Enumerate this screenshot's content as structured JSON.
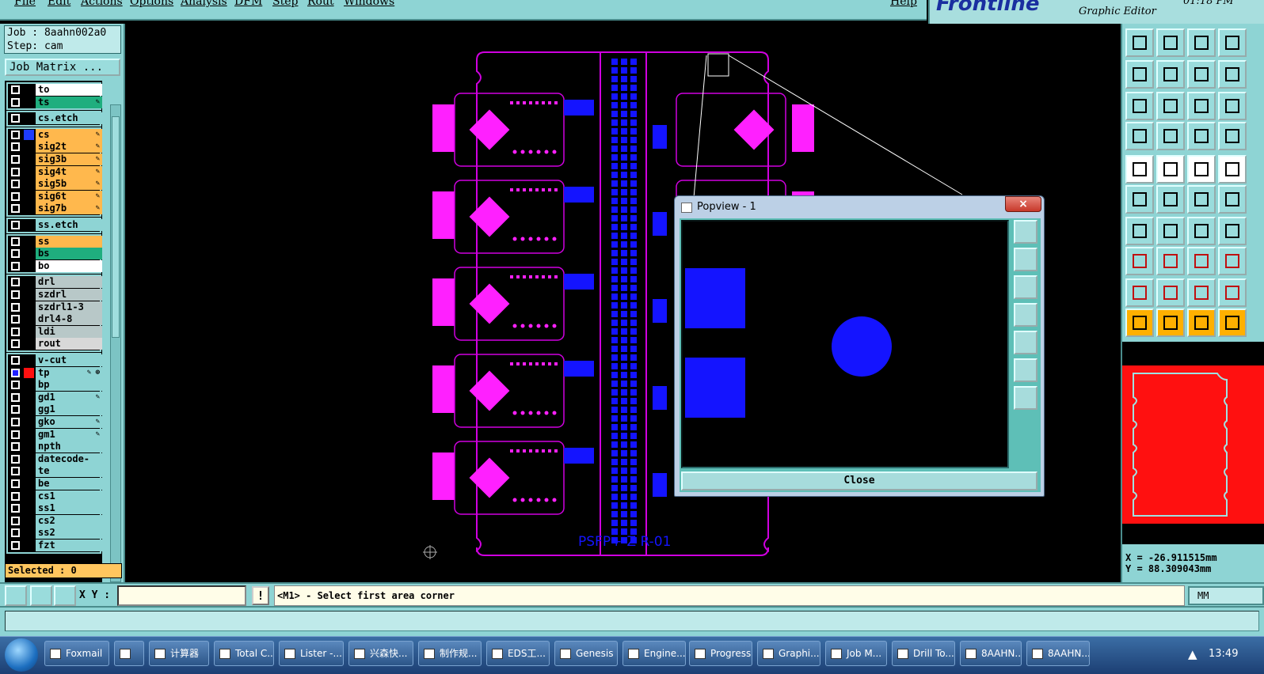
{
  "menu": {
    "items": [
      "File",
      "Edit",
      "Actions",
      "Options",
      "Analysis",
      "DFM",
      "Step",
      "Rout",
      "Windows"
    ],
    "help": "Help"
  },
  "logo": {
    "brand": "Frontline",
    "subtitle": "Graphic Editor",
    "time": "01:18 PM"
  },
  "job": {
    "job_line": "Job : 8aahn002a0",
    "step_line": "Step: cam",
    "matrix_button": "Job Matrix ..."
  },
  "layers": [
    {
      "group": [
        {
          "name": "to",
          "color": "#ffffff",
          "fg": "#000"
        },
        {
          "name": "ts",
          "color": "#1fae7e",
          "fg": "#000",
          "flag": "✎"
        }
      ]
    },
    {
      "group": [
        {
          "name": "cs.etch",
          "color": "#8ed4d4",
          "fg": "#000"
        }
      ]
    },
    {
      "group": [
        {
          "name": "cs",
          "color": "#ffb84d",
          "swatch": "#1e3cff",
          "flag": "✎"
        },
        {
          "name": "sig2t",
          "color": "#ffb84d",
          "flag": "✎"
        },
        {
          "name": "sig3b",
          "color": "#ffb84d",
          "flag": "✎"
        },
        {
          "name": "sig4t",
          "color": "#ffb84d",
          "flag": "✎"
        },
        {
          "name": "sig5b",
          "color": "#ffb84d",
          "flag": "✎"
        },
        {
          "name": "sig6t",
          "color": "#ffb84d",
          "flag": "✎"
        },
        {
          "name": "sig7b",
          "color": "#ffb84d",
          "flag": "✎"
        }
      ]
    },
    {
      "group": [
        {
          "name": "ss.etch",
          "color": "#8ed4d4"
        }
      ]
    },
    {
      "group": [
        {
          "name": "ss",
          "color": "#ffb84d"
        },
        {
          "name": "bs",
          "color": "#1fae7e"
        },
        {
          "name": "bo",
          "color": "#ffffff"
        }
      ]
    },
    {
      "group": [
        {
          "name": "drl",
          "color": "#b8c8c8"
        },
        {
          "name": "szdrl",
          "color": "#b8c8c8"
        },
        {
          "name": "szdrl1-3",
          "color": "#b8c8c8"
        },
        {
          "name": "drl4-8",
          "color": "#b8c8c8"
        },
        {
          "name": "ldi",
          "color": "#b8c8c8"
        },
        {
          "name": "rout",
          "color": "#d8d8d8"
        }
      ]
    },
    {
      "group": [
        {
          "name": "v-cut",
          "color": "#8ed4d4"
        },
        {
          "name": "tp",
          "color": "#8ed4d4",
          "swatch": "#ff1010",
          "checked": true,
          "flag": "✎ ⊕"
        },
        {
          "name": "bp",
          "color": "#8ed4d4"
        },
        {
          "name": "gd1",
          "color": "#8ed4d4",
          "flag": "✎"
        },
        {
          "name": "gg1",
          "color": "#8ed4d4"
        },
        {
          "name": "gko",
          "color": "#8ed4d4",
          "flag": "✎"
        },
        {
          "name": "gm1",
          "color": "#8ed4d4",
          "flag": "✎"
        },
        {
          "name": "npth",
          "color": "#8ed4d4"
        },
        {
          "name": "datecode-pbe",
          "color": "#8ed4d4"
        },
        {
          "name": "te",
          "color": "#8ed4d4"
        },
        {
          "name": "be",
          "color": "#8ed4d4"
        },
        {
          "name": "cs1",
          "color": "#8ed4d4"
        },
        {
          "name": "ss1",
          "color": "#8ed4d4"
        },
        {
          "name": "cs2",
          "color": "#8ed4d4"
        },
        {
          "name": "ss2",
          "color": "#8ed4d4"
        },
        {
          "name": "fzt",
          "color": "#8ed4d4"
        }
      ]
    }
  ],
  "selected": "Selected : 0",
  "board": {
    "text": "PSFP+-Z R-01"
  },
  "popup": {
    "title": "Popview - 1",
    "close_label": "Close",
    "close_x": "×"
  },
  "coords": {
    "x": "X = -26.911515mm",
    "y": "Y = 88.309043mm"
  },
  "command": {
    "xy_label": "X Y :",
    "xy_value": "",
    "excl": "!",
    "prompt": "<M1> - Select first area corner",
    "units": "MM"
  },
  "taskbar": {
    "buttons": [
      "Foxmail",
      "",
      "计算器",
      "Total C...",
      "Lister -...",
      "兴森快...",
      "制作规...",
      "EDS工...",
      "Genesis",
      "Engine...",
      "Progress",
      "Graphi...",
      "Job M...",
      "Drill To...",
      "8AAHN...",
      "8AAHN..."
    ],
    "clock": "13:49"
  },
  "colors": {
    "panel": "#8ed4d4",
    "copper": "#ff20ff",
    "pad": "#1414ff",
    "outline": "#d000e0"
  }
}
